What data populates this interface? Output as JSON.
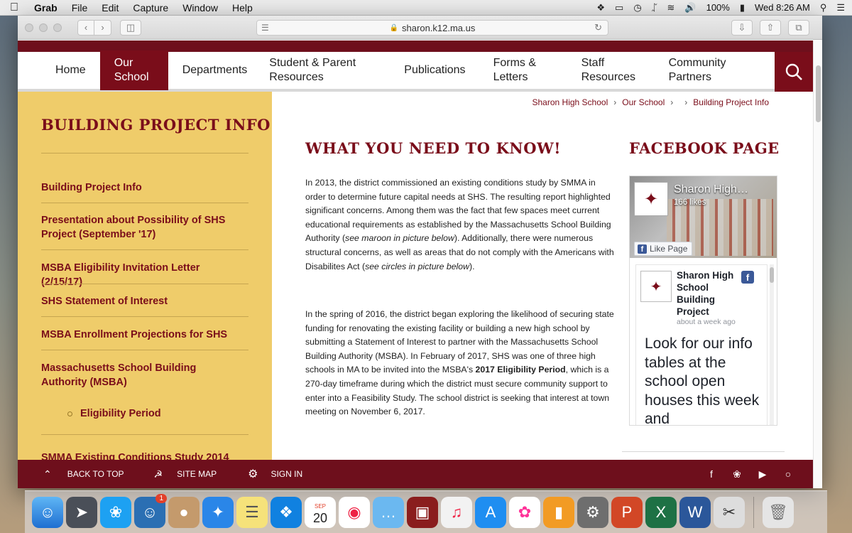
{
  "menubar": {
    "app": "Grab",
    "items": [
      "File",
      "Edit",
      "Capture",
      "Window",
      "Help"
    ],
    "battery": "100%",
    "clock": "Wed 8:26 AM"
  },
  "browser": {
    "url": "sharon.k12.ma.us"
  },
  "nav": {
    "items": [
      "Home",
      "Our School",
      "Departments",
      "Student & Parent Resources",
      "Publications",
      "Forms & Letters",
      "Staff Resources",
      "Community Partners"
    ],
    "active_index": 1
  },
  "breadcrumb": [
    "Sharon High School",
    "Our School",
    "Building Project Info"
  ],
  "sidebar": {
    "title": "BUILDING PROJECT INFO",
    "links": [
      "Building Project Info",
      "Presentation about Possibility of SHS Project (September '17)",
      "MSBA Eligibility Invitation Letter (2/15/17)",
      "SHS Statement of Interest",
      "MSBA Enrollment Projections for SHS",
      "Massachusetts School Building Authority (MSBA)",
      "Eligibility Period",
      "SMMA Existing Conditions Study 2014"
    ]
  },
  "main": {
    "heading": "WHAT YOU NEED TO KNOW!",
    "p1_a": "In 2013, the district commissioned an existing conditions study by SMMA in order to determine future capital needs at SHS. The resulting report highlighted significant concerns. Among them was the fact that few spaces meet current educational requirements as established by the Massachusetts School Building Authority (",
    "p1_em1": "see maroon in picture below",
    "p1_b": "). Additionally, there were numerous structural concerns, as well as areas that do not comply with the Americans with Disabilites Act (",
    "p1_em2": "see circles in picture below",
    "p1_c": ").",
    "p2_a": "In the spring of 2016, the district began exploring the likelihood of securing state funding for renovating the existing facility or building a new high school by submitting a Statement of Interest to partner with the Massachusetts School Building Authority (MSBA).  In February of 2017, SHS was one of three high schools in MA to be invited into the MSBA's ",
    "p2_strong": "2017 Eligibility Period",
    "p2_b": ", which is a 270-day timeframe during which the district must secure community support to enter into a Feasibility Study. The school district is seeking that interest at town meeting on November 6, 2017."
  },
  "facebook": {
    "heading": "FACEBOOK PAGE",
    "page_name": "Sharon High…",
    "likes": "166 likes",
    "like_button": "Like Page",
    "post_author": "Sharon High School Building Project",
    "post_when": "about a week ago",
    "post_text": "Look for our info tables at the school open houses this week and"
  },
  "footer": {
    "back_to_top": "BACK TO TOP",
    "site_map": "SITE MAP",
    "sign_in": "SIGN IN"
  },
  "dock": {
    "calendar_month": "SEP",
    "calendar_day": "20",
    "badge": "1"
  },
  "colors": {
    "maroon": "#7a0d1a",
    "gold": "#efcc6a"
  }
}
